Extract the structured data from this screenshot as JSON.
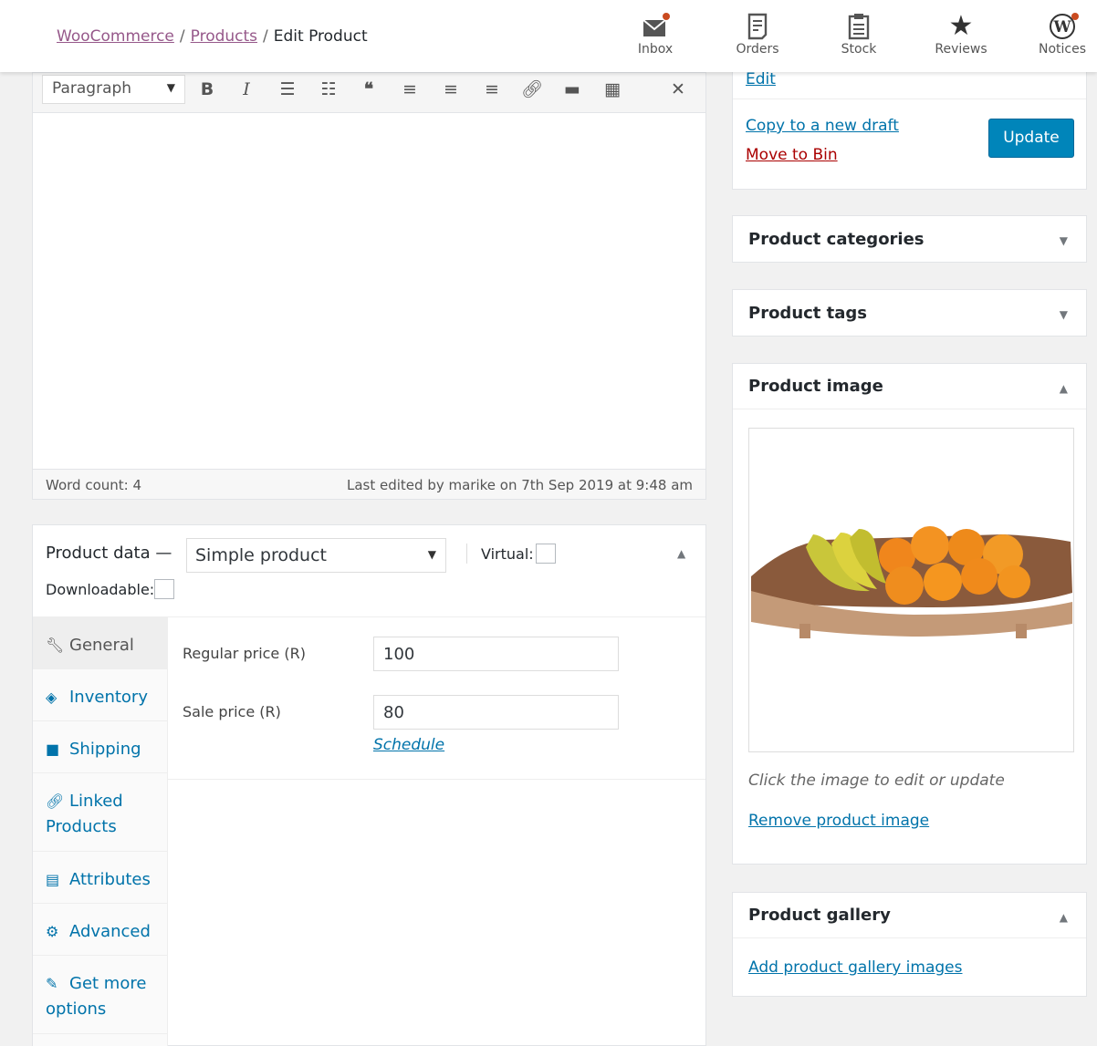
{
  "breadcrumb": {
    "root": "WooCommerce",
    "section": "Products",
    "sep": "/",
    "current": "Edit Product"
  },
  "topnav": [
    {
      "label": "Inbox",
      "icon": "inbox-icon"
    },
    {
      "label": "Orders",
      "icon": "orders-icon"
    },
    {
      "label": "Stock",
      "icon": "stock-icon"
    },
    {
      "label": "Reviews",
      "icon": "star-icon"
    },
    {
      "label": "Notices",
      "icon": "wordpress-icon"
    }
  ],
  "editor": {
    "format_select": "Paragraph",
    "word_count": "Word count: 4",
    "last_edited": "Last edited by marike on 7th Sep 2019 at 9:48 am"
  },
  "product_data": {
    "title": "Product data —",
    "type": "Simple product",
    "virtual_label": "Virtual:",
    "downloadable_label": "Downloadable:",
    "tabs": [
      {
        "label": "General",
        "icon": "wrench-icon"
      },
      {
        "label": "Inventory",
        "icon": "tag-icon"
      },
      {
        "label": "Shipping",
        "icon": "truck-icon"
      },
      {
        "label": "Linked Products",
        "icon": "link-icon"
      },
      {
        "label": "Attributes",
        "icon": "list-icon"
      },
      {
        "label": "Advanced",
        "icon": "gear-icon"
      },
      {
        "label": "Get more options",
        "icon": "plugin-icon"
      }
    ],
    "regular_price_label": "Regular price (R)",
    "regular_price": "100",
    "sale_price_label": "Sale price (R)",
    "sale_price": "80",
    "schedule_link": "Schedule"
  },
  "publish": {
    "edit_link": "Edit",
    "copy_link": "Copy to a new draft",
    "bin_link": "Move to Bin",
    "update_button": "Update"
  },
  "sidebar": {
    "categories": "Product categories",
    "tags": "Product tags",
    "image": "Product image",
    "image_hint": "Click the image to edit or update",
    "remove_image": "Remove product image",
    "gallery": "Product gallery",
    "add_gallery": "Add product gallery images"
  },
  "colors": {
    "link": "#0073aa",
    "woo_purple": "#96588a",
    "danger": "#a00",
    "button": "#0085ba"
  }
}
